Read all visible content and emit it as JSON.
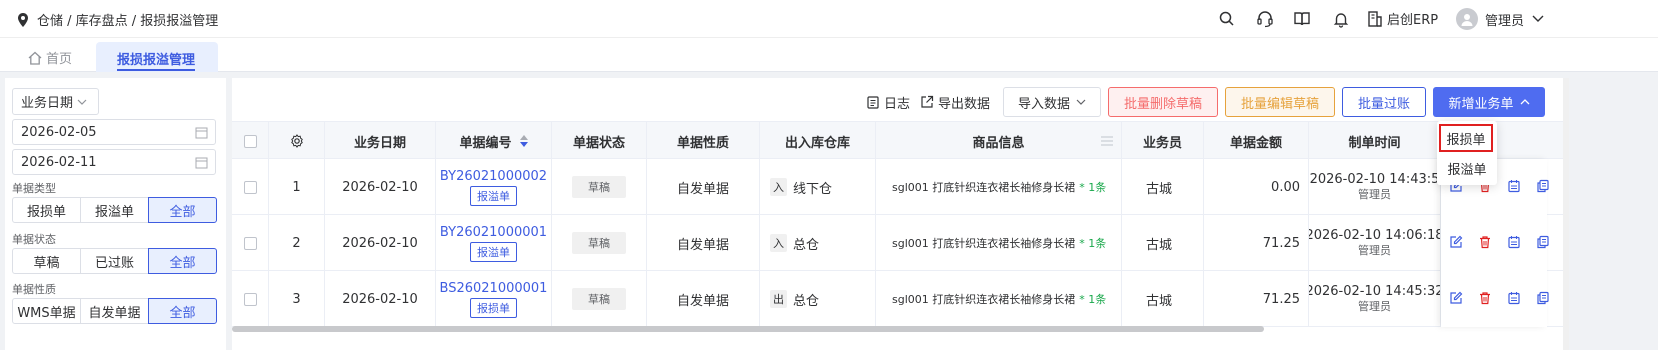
{
  "header": {
    "breadcrumb": "仓储 / 库存盘点 / 报损报溢管理",
    "brand": "启创ERP",
    "user": "管理员"
  },
  "tabs": {
    "home": "首页",
    "active": "报损报溢管理"
  },
  "filter": {
    "date_type": "业务日期",
    "start_date": "2026-02-05",
    "end_date": "2026-02-11",
    "doc_type_label": "单据类型",
    "doc_type_options": [
      "报损单",
      "报溢单",
      "全部"
    ],
    "status_label": "单据状态",
    "status_options": [
      "草稿",
      "已过账",
      "全部"
    ],
    "nature_label": "单据性质",
    "nature_options": [
      "WMS单据",
      "自发单据",
      "全部"
    ]
  },
  "toolbar": {
    "log": "日志",
    "export": "导出数据",
    "import": "导入数据",
    "batch_delete": "批量删除草稿",
    "batch_edit": "批量编辑草稿",
    "batch_post": "批量过账",
    "new_doc": "新增业务单"
  },
  "dropdown": {
    "items": [
      "报损单",
      "报溢单"
    ]
  },
  "table": {
    "columns": [
      "业务日期",
      "单据编号",
      "单据状态",
      "单据性质",
      "出入库仓库",
      "商品信息",
      "业务员",
      "单据金额",
      "制单时间"
    ],
    "rows": [
      {
        "index": "1",
        "date": "2026-02-10",
        "doc_no": "BY26021000002",
        "doc_tag": "报溢单",
        "status": "草稿",
        "nature": "自发单据",
        "dir": "入",
        "warehouse": "线下仓",
        "goods": "sgl001 打底针织连衣裙长袖修身长裙",
        "goods_count": "* 1条",
        "clerk": "古城",
        "amount": "0.00",
        "time": "2026-02-10 14:43:5",
        "creator": "管理员"
      },
      {
        "index": "2",
        "date": "2026-02-10",
        "doc_no": "BY26021000001",
        "doc_tag": "报溢单",
        "status": "草稿",
        "nature": "自发单据",
        "dir": "入",
        "warehouse": "总仓",
        "goods": "sgl001 打底针织连衣裙长袖修身长裙",
        "goods_count": "* 1条",
        "clerk": "古城",
        "amount": "71.25",
        "time": "2026-02-10 14:06:18",
        "creator": "管理员"
      },
      {
        "index": "3",
        "date": "2026-02-10",
        "doc_no": "BS26021000001",
        "doc_tag": "报损单",
        "status": "草稿",
        "nature": "自发单据",
        "dir": "出",
        "warehouse": "总仓",
        "goods": "sgl001 打底针织连衣裙长袖修身长裙",
        "goods_count": "* 1条",
        "clerk": "古城",
        "amount": "71.25",
        "time": "2026-02-10 14:45:32",
        "creator": "管理员"
      }
    ]
  }
}
